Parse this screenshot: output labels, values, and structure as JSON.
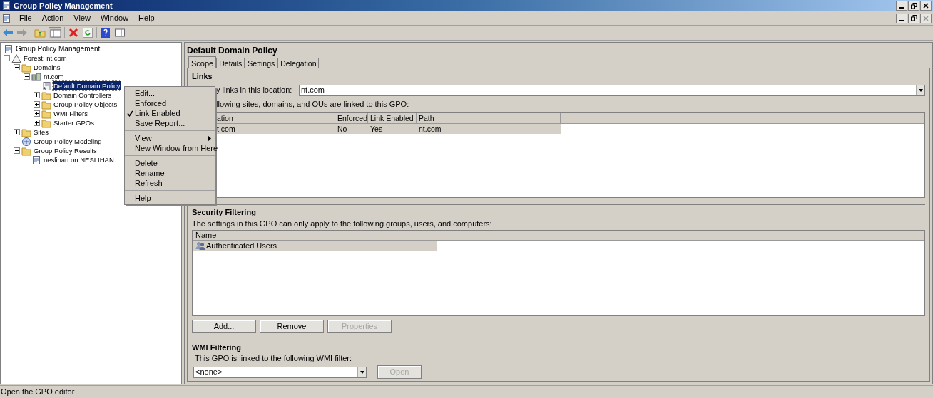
{
  "window": {
    "title": "Group Policy Management"
  },
  "menu_bar": [
    "File",
    "Action",
    "View",
    "Window",
    "Help"
  ],
  "tree": {
    "label": "Group Policy Management",
    "kind": "console",
    "children": [
      {
        "label": "Forest: nt.com",
        "kind": "forest",
        "expandable": true,
        "expanded": true,
        "selected": false,
        "children": [
          {
            "label": "Domains",
            "kind": "folder",
            "expandable": true,
            "expanded": true,
            "selected": false,
            "children": [
              {
                "label": "nt.com",
                "kind": "domain",
                "expandable": true,
                "expanded": true,
                "selected": false,
                "children": [
                  {
                    "label": "Default Domain Policy",
                    "kind": "gpo",
                    "expandable": false,
                    "expanded": false,
                    "selected": true
                  },
                  {
                    "label": "Domain Controllers",
                    "kind": "folder",
                    "expandable": true,
                    "expanded": false,
                    "selected": false
                  },
                  {
                    "label": "Group Policy Objects",
                    "kind": "folder",
                    "expandable": true,
                    "expanded": false,
                    "selected": false
                  },
                  {
                    "label": "WMI Filters",
                    "kind": "folder",
                    "expandable": true,
                    "expanded": false,
                    "selected": false
                  },
                  {
                    "label": "Starter GPOs",
                    "kind": "folder",
                    "expandable": true,
                    "expanded": false,
                    "selected": false
                  }
                ]
              }
            ]
          },
          {
            "label": "Sites",
            "kind": "folder",
            "expandable": true,
            "expanded": false,
            "selected": false
          },
          {
            "label": "Group Policy Modeling",
            "kind": "modeling",
            "expandable": false,
            "expanded": false,
            "selected": false
          },
          {
            "label": "Group Policy Results",
            "kind": "folder",
            "expandable": true,
            "expanded": true,
            "selected": false,
            "children": [
              {
                "label": "neslihan on NESLIHAN",
                "kind": "report",
                "expandable": false,
                "expanded": false,
                "selected": false
              }
            ]
          }
        ]
      }
    ]
  },
  "context_menu": {
    "groups": [
      [
        {
          "label": "Edit...",
          "checked": false,
          "submenu": false
        },
        {
          "label": "Enforced",
          "checked": false,
          "submenu": false
        },
        {
          "label": "Link Enabled",
          "checked": true,
          "submenu": false
        },
        {
          "label": "Save Report...",
          "checked": false,
          "submenu": false
        }
      ],
      [
        {
          "label": "View",
          "checked": false,
          "submenu": true
        },
        {
          "label": "New Window from Here",
          "checked": false,
          "submenu": false
        }
      ],
      [
        {
          "label": "Delete",
          "checked": false,
          "submenu": false
        },
        {
          "label": "Rename",
          "checked": false,
          "submenu": false
        },
        {
          "label": "Refresh",
          "checked": false,
          "submenu": false
        }
      ],
      [
        {
          "label": "Help",
          "checked": false,
          "submenu": false
        }
      ]
    ]
  },
  "details": {
    "title": "Default Domain Policy",
    "tabs": [
      {
        "label": "Scope",
        "selected": true
      },
      {
        "label": "Details",
        "selected": false
      },
      {
        "label": "Settings",
        "selected": false
      },
      {
        "label": "Delegation",
        "selected": false
      }
    ],
    "links": {
      "heading": "Links",
      "location_label": "y links in this location:",
      "location_value": "nt.com",
      "intro": "llowing sites, domains, and OUs are linked to this GPO:",
      "columns": [
        "ation",
        "Enforced",
        "Link Enabled",
        "Path"
      ],
      "rows": [
        [
          "t.com",
          "No",
          "Yes",
          "nt.com"
        ]
      ]
    },
    "security": {
      "heading": "Security Filtering",
      "intro": "The settings in this GPO can only apply to the following groups, users, and computers:",
      "column": "Name",
      "rows": [
        "Authenticated Users"
      ],
      "buttons": [
        {
          "label": "Add...",
          "disabled": false
        },
        {
          "label": "Remove",
          "disabled": false
        },
        {
          "label": "Properties",
          "disabled": true
        }
      ]
    },
    "wmi": {
      "heading": "WMI Filtering",
      "intro": "This GPO is linked to the following WMI filter:",
      "value": "<none>",
      "button": {
        "label": "Open",
        "disabled": true
      }
    }
  },
  "status_bar": "Open the GPO editor"
}
